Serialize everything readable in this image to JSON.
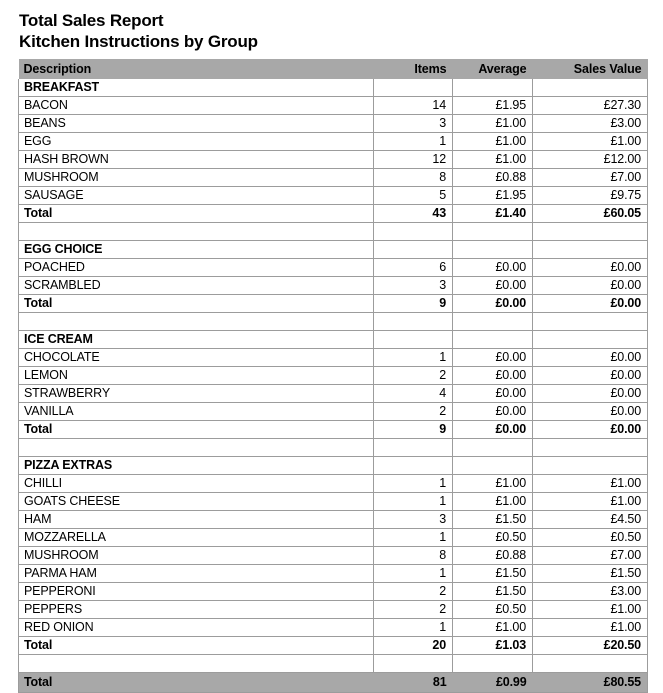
{
  "report": {
    "title_line_1": "Total Sales Report",
    "title_line_2": "Kitchen Instructions by Group",
    "header_bg": "#a8a8a8",
    "grid_color": "#9c9c9c"
  },
  "columns": {
    "description": "Description",
    "items": "Items",
    "average": "Average",
    "sales_value": "Sales Value"
  },
  "groups": [
    {
      "name": "BREAKFAST",
      "rows": [
        {
          "description": "BACON",
          "items": "14",
          "average": "£1.95",
          "sales_value": "£27.30"
        },
        {
          "description": "BEANS",
          "items": "3",
          "average": "£1.00",
          "sales_value": "£3.00"
        },
        {
          "description": "EGG",
          "items": "1",
          "average": "£1.00",
          "sales_value": "£1.00"
        },
        {
          "description": "HASH BROWN",
          "items": "12",
          "average": "£1.00",
          "sales_value": "£12.00"
        },
        {
          "description": "MUSHROOM",
          "items": "8",
          "average": "£0.88",
          "sales_value": "£7.00"
        },
        {
          "description": "SAUSAGE",
          "items": "5",
          "average": "£1.95",
          "sales_value": "£9.75"
        }
      ],
      "total": {
        "description": "Total",
        "items": "43",
        "average": "£1.40",
        "sales_value": "£60.05"
      }
    },
    {
      "name": "EGG CHOICE",
      "rows": [
        {
          "description": "POACHED",
          "items": "6",
          "average": "£0.00",
          "sales_value": "£0.00"
        },
        {
          "description": "SCRAMBLED",
          "items": "3",
          "average": "£0.00",
          "sales_value": "£0.00"
        }
      ],
      "total": {
        "description": "Total",
        "items": "9",
        "average": "£0.00",
        "sales_value": "£0.00"
      }
    },
    {
      "name": "ICE CREAM",
      "rows": [
        {
          "description": "CHOCOLATE",
          "items": "1",
          "average": "£0.00",
          "sales_value": "£0.00"
        },
        {
          "description": "LEMON",
          "items": "2",
          "average": "£0.00",
          "sales_value": "£0.00"
        },
        {
          "description": "STRAWBERRY",
          "items": "4",
          "average": "£0.00",
          "sales_value": "£0.00"
        },
        {
          "description": "VANILLA",
          "items": "2",
          "average": "£0.00",
          "sales_value": "£0.00"
        }
      ],
      "total": {
        "description": "Total",
        "items": "9",
        "average": "£0.00",
        "sales_value": "£0.00"
      }
    },
    {
      "name": "PIZZA EXTRAS",
      "rows": [
        {
          "description": "CHILLI",
          "items": "1",
          "average": "£1.00",
          "sales_value": "£1.00"
        },
        {
          "description": "GOATS CHEESE",
          "items": "1",
          "average": "£1.00",
          "sales_value": "£1.00"
        },
        {
          "description": "HAM",
          "items": "3",
          "average": "£1.50",
          "sales_value": "£4.50"
        },
        {
          "description": "MOZZARELLA",
          "items": "1",
          "average": "£0.50",
          "sales_value": "£0.50"
        },
        {
          "description": "MUSHROOM",
          "items": "8",
          "average": "£0.88",
          "sales_value": "£7.00"
        },
        {
          "description": "PARMA HAM",
          "items": "1",
          "average": "£1.50",
          "sales_value": "£1.50"
        },
        {
          "description": "PEPPERONI",
          "items": "2",
          "average": "£1.50",
          "sales_value": "£3.00"
        },
        {
          "description": "PEPPERS",
          "items": "2",
          "average": "£0.50",
          "sales_value": "£1.00"
        },
        {
          "description": "RED ONION",
          "items": "1",
          "average": "£1.00",
          "sales_value": "£1.00"
        }
      ],
      "total": {
        "description": "Total",
        "items": "20",
        "average": "£1.03",
        "sales_value": "£20.50"
      }
    }
  ],
  "grand_total": {
    "description": "Total",
    "items": "81",
    "average": "£0.99",
    "sales_value": "£80.55"
  }
}
